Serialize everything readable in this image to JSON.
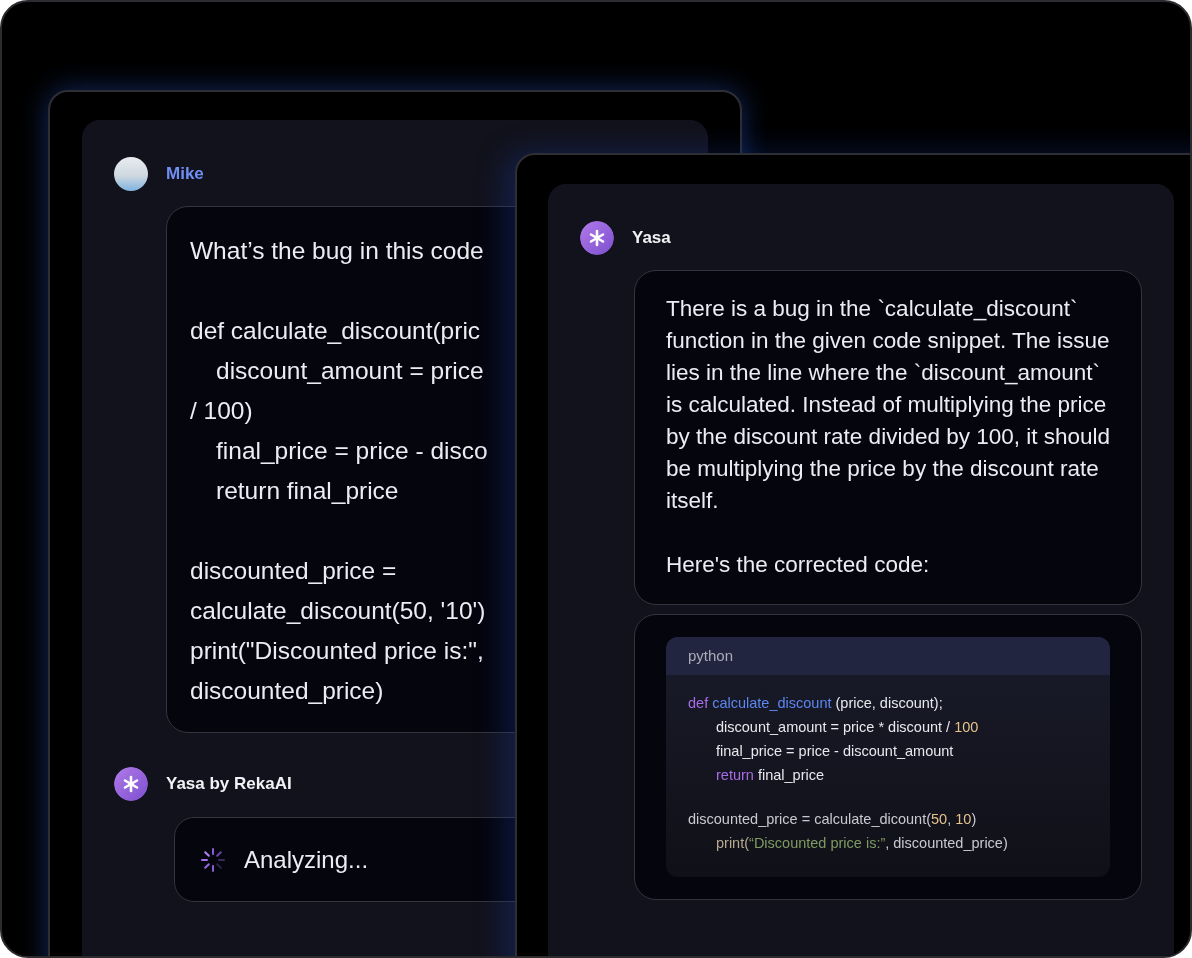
{
  "back_window": {
    "user": {
      "name": "Mike"
    },
    "message_groups": [
      [
        {
          "text": "What’s the bug in this code",
          "indent": false
        }
      ],
      [
        {
          "text": "def calculate_discount(pric",
          "indent": false
        },
        {
          "text": "discount_amount = price",
          "indent": true
        },
        {
          "text": "/ 100)",
          "indent": false
        },
        {
          "text": "final_price = price - disco",
          "indent": true
        },
        {
          "text": "return final_price",
          "indent": true
        }
      ],
      [
        {
          "text": "discounted_price =",
          "indent": false
        },
        {
          "text": "calculate_discount(50, '10')",
          "indent": false
        },
        {
          "text": "print(\"Discounted price is:\",",
          "indent": false
        },
        {
          "text": "discounted_price)",
          "indent": false
        }
      ]
    ],
    "assistant": {
      "name": "Yasa by RekaAI"
    },
    "status": "Analyzing..."
  },
  "front_window": {
    "assistant": {
      "name": "Yasa"
    },
    "paragraphs": [
      "There is a bug in the `calculate_discount` function in the given code snippet. The issue lies in the line where the `discount_amount` is calculated. Instead of multiplying the price by the discount rate divided by 100, it should be multiplying the price by the discount rate itself.",
      "Here's the corrected code:"
    ],
    "code_block": {
      "language": "python",
      "groups": [
        [
          {
            "indent": false,
            "tokens": [
              {
                "kind": "keyword",
                "text": "def "
              },
              {
                "kind": "function",
                "text": "calculate_discount"
              },
              {
                "kind": "plain",
                "text": " (price, discount);"
              }
            ]
          },
          {
            "indent": true,
            "tokens": [
              {
                "kind": "plain",
                "text": "discount_amount = price * discount / "
              },
              {
                "kind": "number",
                "text": "100"
              }
            ]
          },
          {
            "indent": true,
            "tokens": [
              {
                "kind": "plain",
                "text": "final_price = price - discount_amount"
              }
            ]
          },
          {
            "indent": true,
            "tokens": [
              {
                "kind": "keyword",
                "text": "return "
              },
              {
                "kind": "plain",
                "text": "final_price"
              }
            ]
          }
        ],
        [
          {
            "indent": false,
            "tokens": [
              {
                "kind": "muted",
                "text": "discounted_price = calculate_dicount("
              },
              {
                "kind": "number",
                "text": "50"
              },
              {
                "kind": "muted",
                "text": ", "
              },
              {
                "kind": "number",
                "text": "10"
              },
              {
                "kind": "muted",
                "text": ")"
              }
            ]
          },
          {
            "indent": true,
            "tokens": [
              {
                "kind": "builtin",
                "text": "print("
              },
              {
                "kind": "string",
                "text": "“Discounted price is:”"
              },
              {
                "kind": "muted",
                "text": ", discounted_price)"
              }
            ]
          }
        ]
      ]
    }
  }
}
